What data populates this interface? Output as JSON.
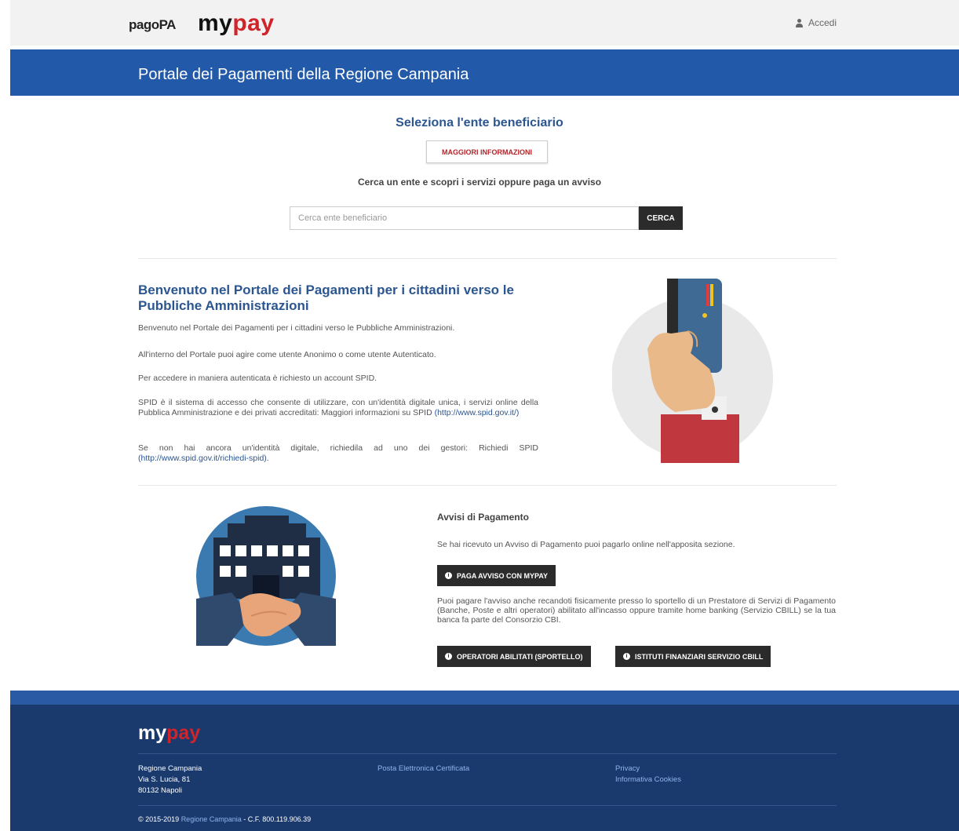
{
  "header": {
    "logo_pagopa": "pagoPA",
    "logo_my": "my",
    "logo_pay": "pay",
    "login_label": "Accedi"
  },
  "banner": {
    "title": "Portale dei Pagamenti della Regione Campania"
  },
  "search": {
    "title": "Seleziona l'ente beneficiario",
    "more_info_label": "MAGGIORI INFORMAZIONI",
    "subtitle": "Cerca un ente e scopri i servizi oppure paga un avviso",
    "placeholder": "Cerca ente beneficiario",
    "button_label": "CERCA"
  },
  "welcome": {
    "title": "Benvenuto nel Portale dei Pagamenti per i cittadini verso le Pubbliche Amministrazioni",
    "p1": "Benvenuto nel Portale dei Pagamenti per i cittadini verso le Pubbliche Amministrazioni.",
    "p2": "All'interno del Portale puoi agire come utente Anonimo o come utente Autenticato.",
    "p3": "Per accedere in maniera autenticata è richiesto un account SPID.",
    "p4": "SPID è il sistema di accesso che consente di utilizzare, con un'identità digitale unica, i servizi online della Pubblica Amministrazione e dei privati accreditati: Maggiori informazioni su SPID",
    "p4_link": "(http://www.spid.gov.it/)",
    "p5": "Se non hai ancora un'identità digitale, richiedila ad uno dei gestori: Richiedi SPID",
    "p5_link": "(http://www.spid.gov.it/richiedi-spid)",
    "p5_end": "."
  },
  "avvisi": {
    "title": "Avvisi di Pagamento",
    "text": "Se hai ricevuto un Avviso di Pagamento puoi pagarlo online nell'apposita sezione.",
    "pay_button": "PAGA AVVISO CON MYPAY",
    "long_text": "Puoi pagare l'avviso anche recandoti fisicamente presso lo sportello di un Prestatore di Servizi di Pagamento (Banche, Poste e altri operatori) abilitato all'incasso oppure tramite home banking (Servizio CBILL) se la tua banca fa parte del Consorzio CBI.",
    "operators_button": "OPERATORI ABILITATI (SPORTELLO)",
    "cbill_button": "ISTITUTI FINANZIARI SERVIZIO CBILL"
  },
  "footer": {
    "logo_my": "my",
    "logo_pay": "pay",
    "address": [
      "Regione Campania",
      "Via S. Lucia, 81",
      "80132 Napoli"
    ],
    "pec": "Posta Elettronica Certificata",
    "privacy": "Privacy",
    "cookies": "Informativa Cookies",
    "copyright_pre": "© 2015-2019",
    "copyright_link": "Regione Campania",
    "copyright_post": "- C.F. 800.119.906.39"
  },
  "colors": {
    "primary_blue": "#2259a8",
    "title_blue": "#2b5691",
    "brand_red": "#d0242b",
    "footer_bg": "#1a3a6e",
    "dark_button": "#2b2b2b"
  }
}
